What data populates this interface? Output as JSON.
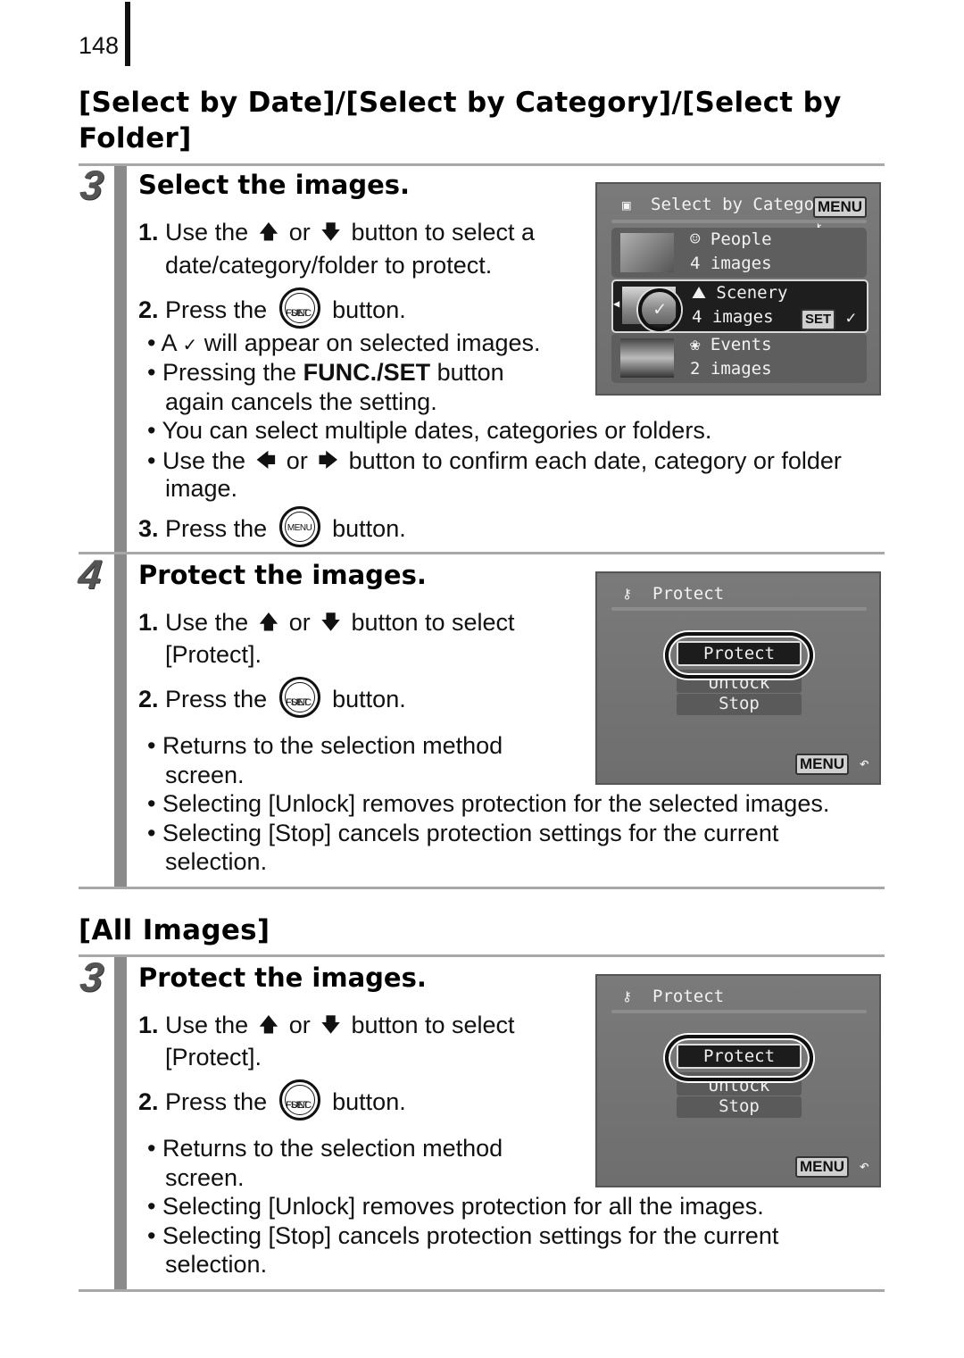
{
  "page_number": "148",
  "section1": {
    "title_line1": "[Select by Date]/[Select by Category]/[Select by",
    "title_line2": "Folder]"
  },
  "step3a": {
    "number": "3",
    "title": "Select the images.",
    "items": [
      {
        "num": "1.",
        "pre": "Use the",
        "arrow1": "🡅",
        "mid": "or",
        "arrow2": "🡇",
        "post": "button to select a",
        "line2": "date/category/folder to protect."
      },
      {
        "num": "2.",
        "pre": "Press the",
        "button_top": "FUNC.",
        "button_bottom": "SET",
        "post": "button."
      }
    ],
    "bullets": [
      {
        "text_a": "A",
        "check": "✓",
        "text_b": "will appear on selected images."
      },
      {
        "text_a": "Pressing the",
        "bold": "FUNC./SET",
        "text_b": "button",
        "line2": "again cancels the setting."
      },
      {
        "text": "You can select multiple dates, categories or folders."
      },
      {
        "pre": "Use the",
        "arrow1": "🡄",
        "mid": "or",
        "arrow2": "🡆",
        "post": "button to confirm each date, category or folder",
        "line2": "image."
      }
    ],
    "item3": {
      "num": "3.",
      "pre": "Press the",
      "button": "MENU",
      "post": "button."
    },
    "screen": {
      "header": "Select by Category",
      "menu_badge": "MENU",
      "rows": [
        {
          "name": "People",
          "count": "4 images",
          "selected": false
        },
        {
          "name": "Scenery",
          "count": "4 images",
          "selected": true,
          "set_badge": "SET",
          "check": "✓"
        },
        {
          "name": "Events",
          "count": "2 images",
          "selected": false
        }
      ]
    }
  },
  "step4": {
    "number": "4",
    "title": "Protect the images.",
    "items": [
      {
        "num": "1.",
        "pre": "Use the",
        "arrow1": "🡅",
        "mid": "or",
        "arrow2": "🡇",
        "post": "button to select",
        "line2": "[Protect]."
      },
      {
        "num": "2.",
        "pre": "Press the",
        "button_top": "FUNC.",
        "button_bottom": "SET",
        "post": "button."
      }
    ],
    "bullets": [
      {
        "text": "Returns to the selection method",
        "line2": "screen."
      },
      {
        "text": "Selecting [Unlock] removes protection for the selected images."
      },
      {
        "text": "Selecting [Stop] cancels protection settings for the current",
        "line2": "selection."
      }
    ],
    "screen": {
      "header": "Protect",
      "options": [
        "Protect",
        "Unlock",
        "Stop"
      ],
      "selected": "Protect",
      "menu_badge": "MENU",
      "back": "↶"
    }
  },
  "section2": {
    "title": "[All Images]"
  },
  "step3b": {
    "number": "3",
    "title": "Protect the images.",
    "items": [
      {
        "num": "1.",
        "pre": "Use the",
        "arrow1": "🡅",
        "mid": "or",
        "arrow2": "🡇",
        "post": "button to select",
        "line2": "[Protect]."
      },
      {
        "num": "2.",
        "pre": "Press the",
        "button_top": "FUNC.",
        "button_bottom": "SET",
        "post": "button."
      }
    ],
    "bullets": [
      {
        "text": "Returns to the selection method",
        "line2": "screen."
      },
      {
        "text": "Selecting [Unlock] removes protection for all the images."
      },
      {
        "text": "Selecting [Stop] cancels protection settings for the current",
        "line2": "selection."
      }
    ],
    "screen": {
      "header": "Protect",
      "options": [
        "Protect",
        "Unlock",
        "Stop"
      ],
      "selected": "Protect",
      "menu_badge": "MENU",
      "back": "↶"
    }
  }
}
